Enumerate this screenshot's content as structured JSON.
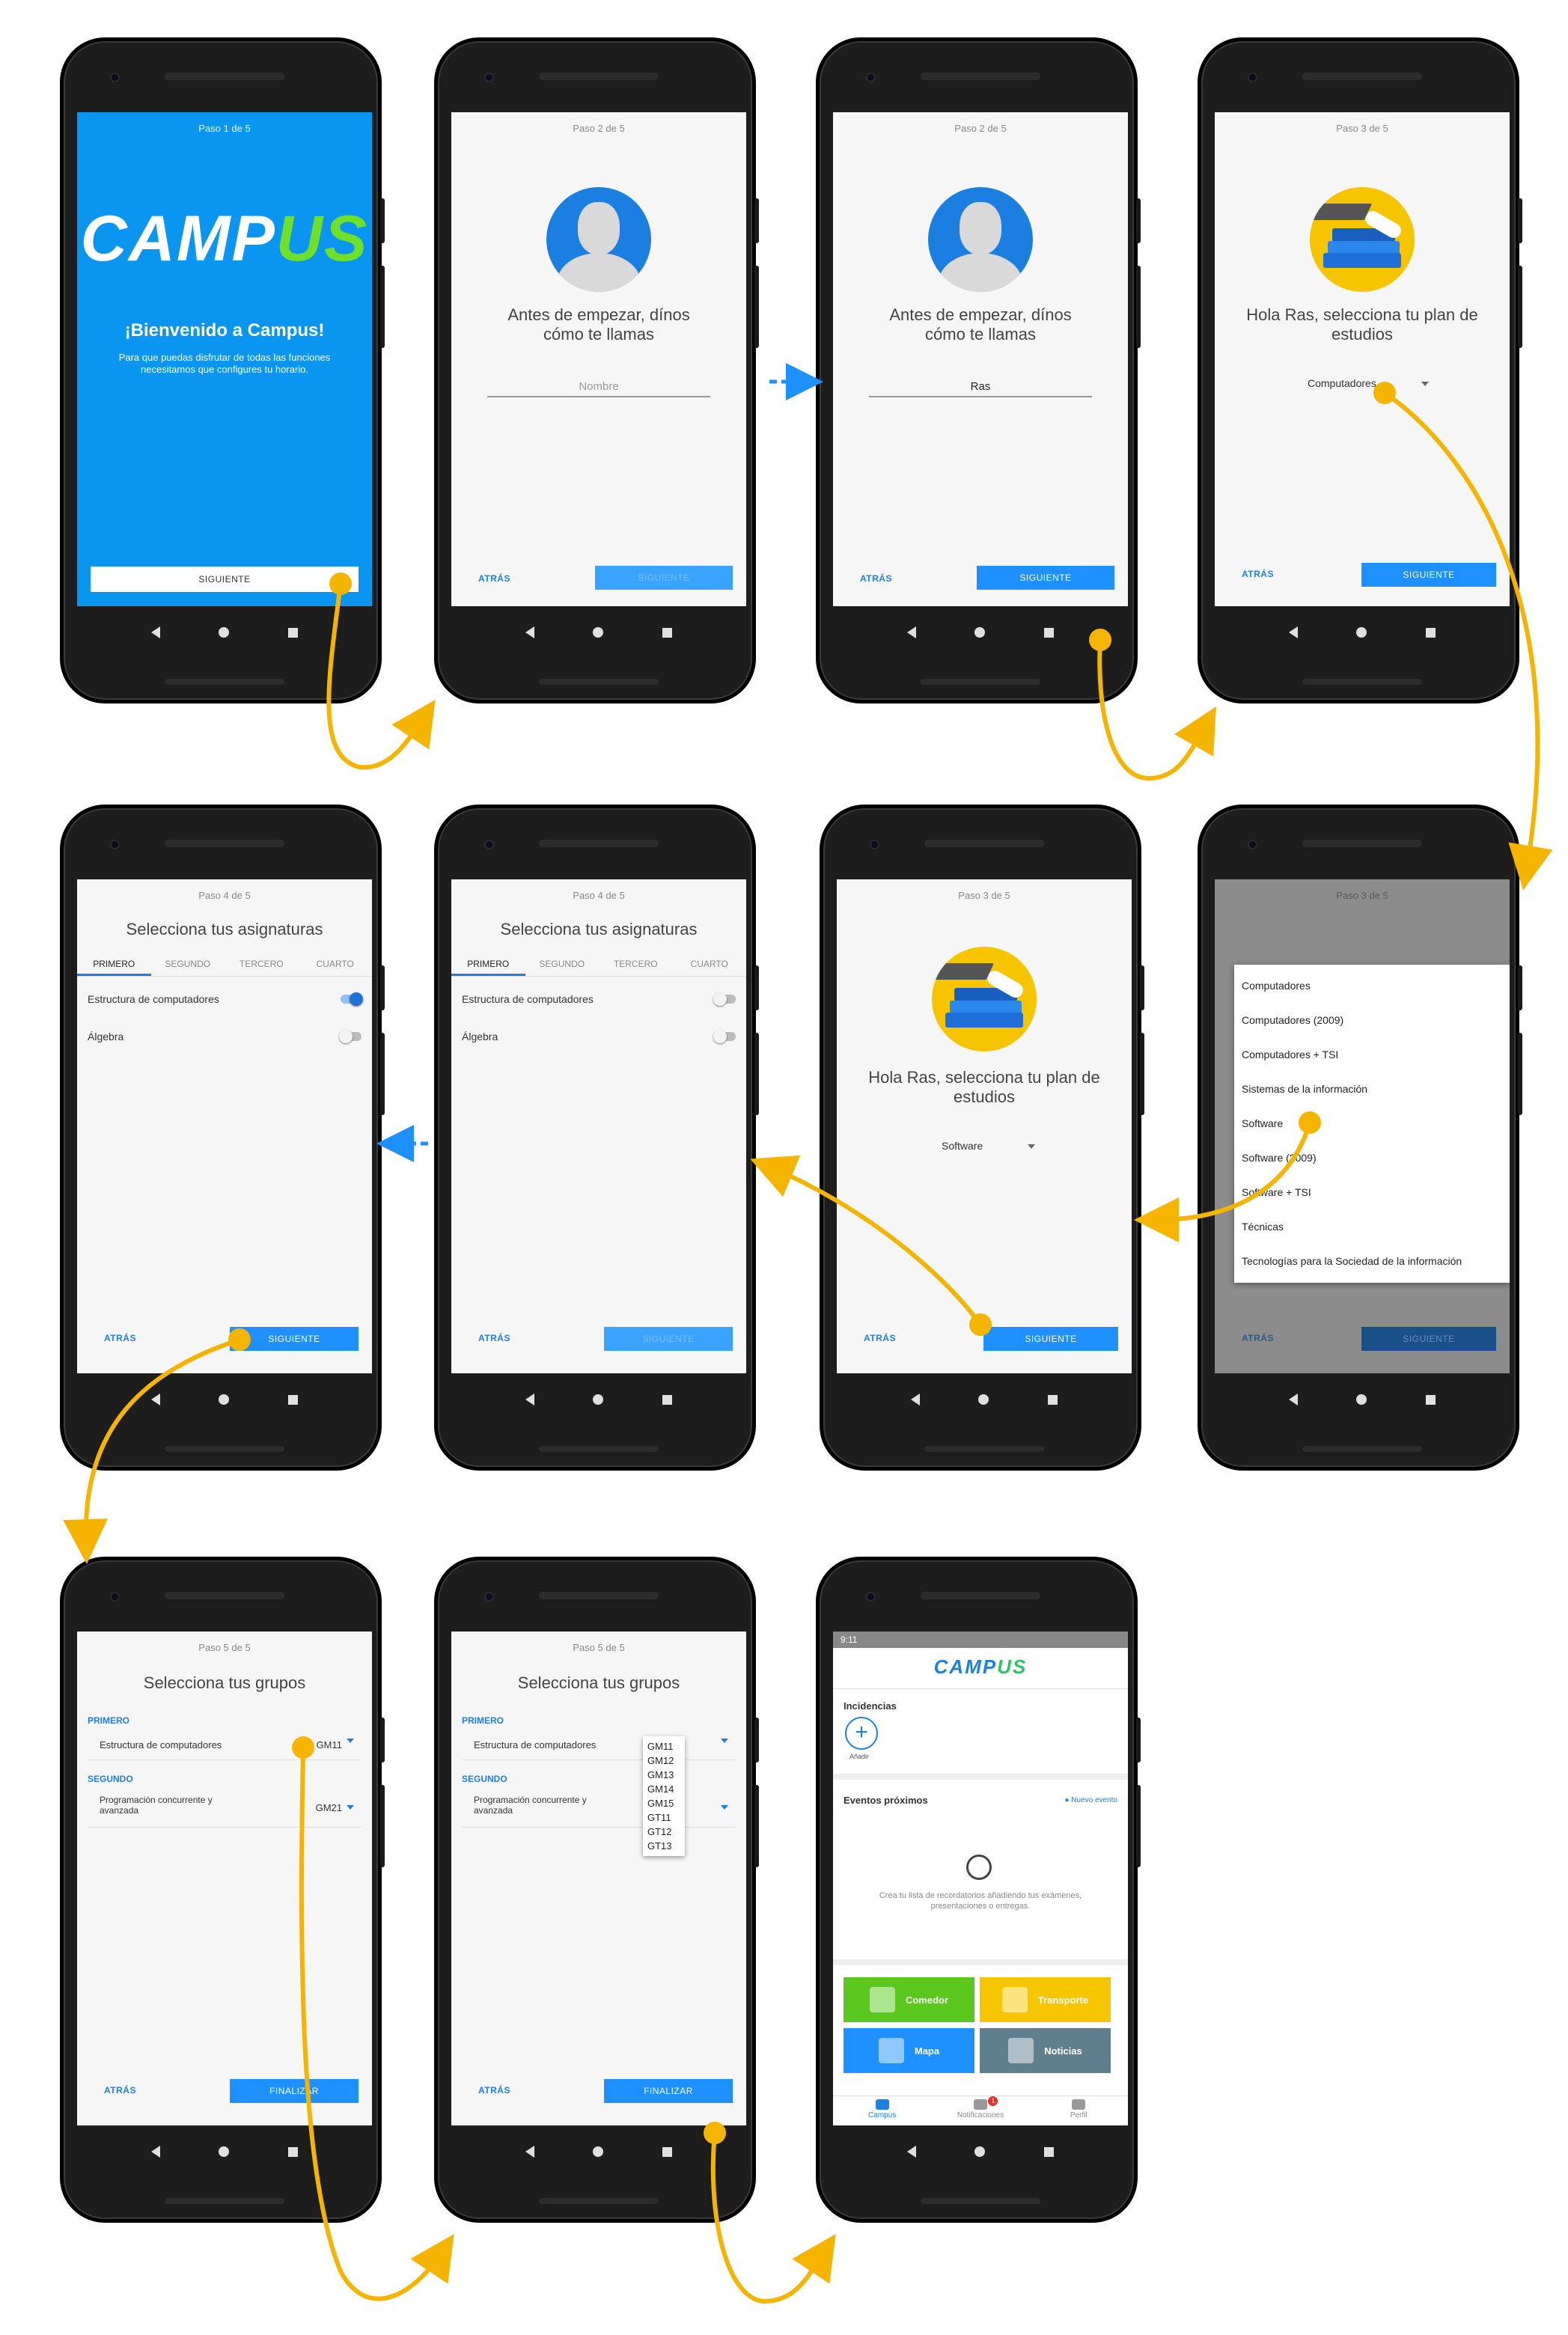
{
  "p1": {
    "step": "Paso 1 de 5",
    "logo_a": "CAMP",
    "logo_b": "US",
    "title": "¡Bienvenido a Campus!",
    "body": "Para que puedas disfrutar de todas las funciones necesitamos que configures tu horario.",
    "next": "SIGUIENTE"
  },
  "p2": {
    "step": "Paso 2 de 5",
    "title": "Antes de empezar, dínos cómo te llamas",
    "placeholder": "Nombre",
    "back": "ATRÁS",
    "next": "SIGUIENTE"
  },
  "p3": {
    "step": "Paso 2 de 5",
    "title": "Antes de empezar, dínos cómo te llamas",
    "value": "Ras",
    "back": "ATRÁS",
    "next": "SIGUIENTE"
  },
  "p4": {
    "step": "Paso 3 de 5",
    "title": "Hola Ras, selecciona tu plan de estudios",
    "select": "Computadores",
    "back": "ATRÁS",
    "next": "SIGUIENTE"
  },
  "p5": {
    "step": "Paso 4 de 5",
    "title": "Selecciona tus asignaturas",
    "tabs": [
      "PRIMERO",
      "SEGUNDO",
      "TERCERO",
      "CUARTO"
    ],
    "subjects": [
      "Estructura de computadores",
      "Álgebra"
    ],
    "back": "ATRÁS",
    "next": "SIGUIENTE"
  },
  "p6": {
    "step": "Paso 4 de 5",
    "title": "Selecciona tus asignaturas",
    "tabs": [
      "PRIMERO",
      "SEGUNDO",
      "TERCERO",
      "CUARTO"
    ],
    "subjects": [
      "Estructura de computadores",
      "Álgebra"
    ],
    "back": "ATRÁS",
    "next": "SIGUIENTE"
  },
  "p7": {
    "step": "Paso 3 de 5",
    "title": "Hola Ras, selecciona tu plan de estudios",
    "select": "Software",
    "back": "ATRÁS",
    "next": "SIGUIENTE"
  },
  "p8": {
    "step": "Paso 3 de 5",
    "options": [
      "Computadores",
      "Computadores (2009)",
      "Computadores + TSI",
      "Sistemas de la información",
      "Software",
      "Software (2009)",
      "Software + TSI",
      "Técnicas",
      "Tecnologías para la Sociedad de la información"
    ],
    "back": "ATRÁS",
    "next": "SIGUIENTE"
  },
  "p9": {
    "step": "Paso 5 de 5",
    "title": "Selecciona tus grupos",
    "sec1": "PRIMERO",
    "row1": "Estructura de computadores",
    "val1": "GM11",
    "sec2": "SEGUNDO",
    "row2": "Programación concurrente y avanzada",
    "val2": "GM21",
    "back": "ATRÁS",
    "finish": "FINALIZAR"
  },
  "p10": {
    "step": "Paso 5 de 5",
    "title": "Selecciona tus grupos",
    "sec1": "PRIMERO",
    "row1": "Estructura de computadores",
    "sec2": "SEGUNDO",
    "row2": "Programación concurrente y avanzada",
    "groups": [
      "GM11",
      "GM12",
      "GM13",
      "GM14",
      "GM15",
      "GT11",
      "GT12",
      "GT13"
    ],
    "back": "ATRÁS",
    "finish": "FINALIZAR"
  },
  "p11": {
    "time": "9:11",
    "logo_a": "CAMP",
    "logo_b": "US",
    "incidencias": "Incidencias",
    "anadir": "Añadir",
    "eventos": "Eventos próximos",
    "nuevo": "● Nuevo evento",
    "empty": "Crea tu lista de recordatorios añadiendo tus exámenes, presentaciones o entregas.",
    "tiles": [
      "Comedor",
      "Transporte",
      "Mapa",
      "Noticias"
    ],
    "nav": [
      "Campus",
      "Notificaciones",
      "Perfil"
    ],
    "badge": "1"
  },
  "colors": {
    "accent": "#1e90ff",
    "arrow": "#f5b400",
    "blue_screen": "#0a96f0"
  }
}
